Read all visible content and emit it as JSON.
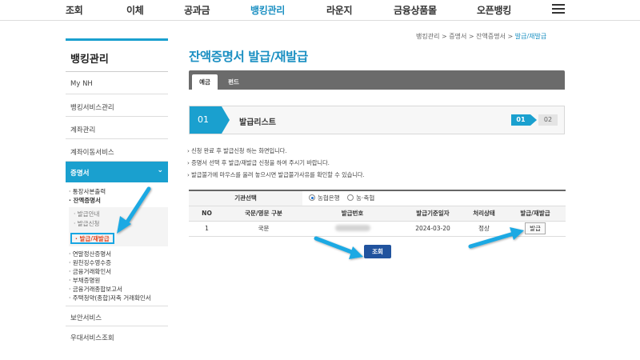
{
  "nav": {
    "items": [
      {
        "label": "조회",
        "active": false
      },
      {
        "label": "이체",
        "active": false
      },
      {
        "label": "공과금",
        "active": false
      },
      {
        "label": "뱅킹관리",
        "active": true
      },
      {
        "label": "라운지",
        "active": false
      },
      {
        "label": "금융상품몰",
        "active": false
      },
      {
        "label": "오픈뱅킹",
        "active": false
      }
    ],
    "menu_icon": "hamburger-icon"
  },
  "sidebar": {
    "title": "뱅킹관리",
    "items": [
      "My NH",
      "뱅킹서비스관리",
      "계좌관리",
      "계좌이동서비스"
    ],
    "active_section": {
      "label": "증명서",
      "icon": "chevron-down-icon"
    },
    "sub": {
      "top": [
        "· 통장사본출력",
        "· 잔액증명서"
      ],
      "nested": [
        "· 발급안내",
        "· 발급신청",
        "· 발급/재발급"
      ],
      "rest": [
        "· 연말정산증명서",
        "· 원천징수영수증",
        "· 금융거래확인서",
        "· 부채증명원",
        "· 금융거래종합보고서",
        "· 주택청약(종합)저축 거래확인서"
      ]
    },
    "bottom": [
      "보안서비스",
      "우대서비스조회"
    ]
  },
  "breadcrumb": {
    "parts": [
      "뱅킹관리",
      "증명서",
      "잔액증명서"
    ],
    "separator": " > ",
    "current": "발급/재발급"
  },
  "page_title": "잔액증명서 발급/재발급",
  "tabs": [
    {
      "label": "예금"
    },
    {
      "label": "펀드"
    }
  ],
  "step": {
    "number": "01",
    "label": "발급리스트",
    "indicator": [
      "01",
      "02"
    ]
  },
  "notes": [
    "신청 완료 후 발급신청 하는 화면입니다.",
    "증명서 선택 후 발급/재발급 신청을 하여 주시기 바랍니다.",
    "발급불가에 마우스를 올려 놓으시면 발급불가사유를 확인할 수 있습니다."
  ],
  "table": {
    "org_label": "기관선택",
    "orgs": [
      {
        "label": "농협은행",
        "selected": true
      },
      {
        "label": "농·축협",
        "selected": false
      }
    ],
    "headers": [
      "NO",
      "국문/영문 구분",
      "발급번호",
      "발급기준일자",
      "처리상태",
      "발급/재발급"
    ],
    "rows": [
      {
        "no": "1",
        "lang": "국문",
        "date": "2024-03-20",
        "status": "정상",
        "action": "발급"
      }
    ]
  },
  "submit_label": "조회",
  "colors": {
    "accent": "#1aa0cf",
    "highlight_arrow": "#1ba9e3",
    "submit": "#21539e"
  }
}
